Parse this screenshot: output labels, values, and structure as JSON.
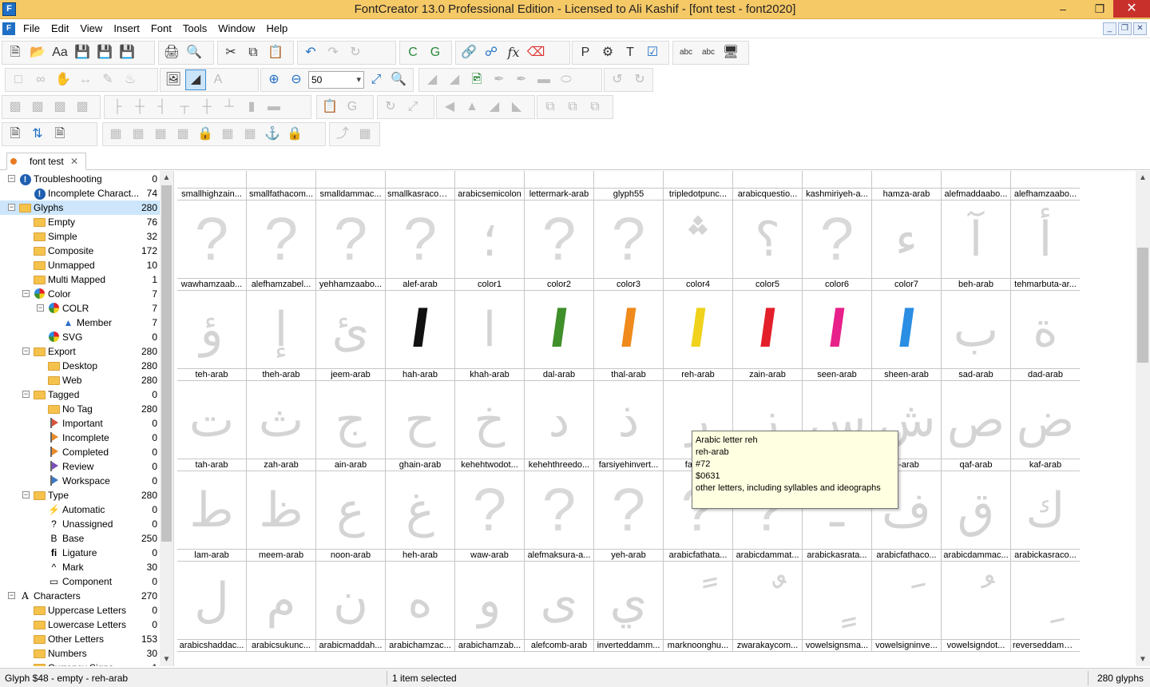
{
  "window": {
    "title": "FontCreator 13.0 Professional Edition - Licensed to Ali Kashif - [font test - font2020]"
  },
  "menu": [
    "File",
    "Edit",
    "View",
    "Insert",
    "Font",
    "Tools",
    "Window",
    "Help"
  ],
  "zoom": {
    "value": "50"
  },
  "doc_tab": {
    "label": "font test"
  },
  "tree": [
    {
      "label": "Troubleshooting",
      "count": "0",
      "icon": "warning-icon"
    },
    {
      "label": "Incomplete Charact...",
      "count": "74",
      "icon": "warning-icon"
    },
    {
      "label": "Glyphs",
      "count": "280",
      "icon": "folder-icon"
    },
    {
      "label": "Empty",
      "count": "76",
      "icon": "folder-icon"
    },
    {
      "label": "Simple",
      "count": "32",
      "icon": "folder-icon"
    },
    {
      "label": "Composite",
      "count": "172",
      "icon": "folder-icon"
    },
    {
      "label": "Unmapped",
      "count": "10",
      "icon": "folder-icon"
    },
    {
      "label": "Multi Mapped",
      "count": "1",
      "icon": "folder-icon"
    },
    {
      "label": "Color",
      "count": "7",
      "icon": "color-wheel-icon"
    },
    {
      "label": "COLR",
      "count": "7",
      "icon": "color-wheel-icon"
    },
    {
      "label": "Member",
      "count": "7",
      "icon": "triangle-icon"
    },
    {
      "label": "SVG",
      "count": "0",
      "icon": "color-wheel-icon"
    },
    {
      "label": "Export",
      "count": "280",
      "icon": "folder-icon"
    },
    {
      "label": "Desktop",
      "count": "280",
      "icon": "folder-icon"
    },
    {
      "label": "Web",
      "count": "280",
      "icon": "folder-icon"
    },
    {
      "label": "Tagged",
      "count": "0",
      "icon": "folder-icon"
    },
    {
      "label": "No Tag",
      "count": "280",
      "icon": "folder-icon"
    },
    {
      "label": "Important",
      "count": "0",
      "icon": "flag-icon"
    },
    {
      "label": "Incomplete",
      "count": "0",
      "icon": "flag-icon"
    },
    {
      "label": "Completed",
      "count": "0",
      "icon": "flag-icon"
    },
    {
      "label": "Review",
      "count": "0",
      "icon": "flag-icon"
    },
    {
      "label": "Workspace",
      "count": "0",
      "icon": "flag-icon"
    },
    {
      "label": "Type",
      "count": "280",
      "icon": "folder-icon"
    },
    {
      "label": "Automatic",
      "count": "0",
      "icon": "lightning-icon"
    },
    {
      "label": "Unassigned",
      "count": "0",
      "icon": "question-icon"
    },
    {
      "label": "Base",
      "count": "250",
      "icon": "letter-b-icon"
    },
    {
      "label": "Ligature",
      "count": "0",
      "icon": "ligature-icon"
    },
    {
      "label": "Mark",
      "count": "30",
      "icon": "caret-icon"
    },
    {
      "label": "Component",
      "count": "0",
      "icon": "component-icon"
    },
    {
      "label": "Characters",
      "count": "270",
      "icon": "letter-a-icon"
    },
    {
      "label": "Uppercase Letters",
      "count": "0",
      "icon": "folder-icon"
    },
    {
      "label": "Lowercase Letters",
      "count": "0",
      "icon": "folder-icon"
    },
    {
      "label": "Other Letters",
      "count": "153",
      "icon": "folder-icon"
    },
    {
      "label": "Numbers",
      "count": "30",
      "icon": "folder-icon"
    },
    {
      "label": "Currency Signs",
      "count": "1",
      "icon": "folder-icon"
    }
  ],
  "glyph_rows": [
    [
      {
        "name": "smallhighzain...",
        "glyph": "",
        "color": ""
      },
      {
        "name": "smallfathacom...",
        "glyph": "",
        "color": ""
      },
      {
        "name": "smalldammac...",
        "glyph": "",
        "color": ""
      },
      {
        "name": "smallkasracom...",
        "glyph": "",
        "color": ""
      },
      {
        "name": "arabicsemicolon",
        "glyph": "",
        "color": ""
      },
      {
        "name": "lettermark-arab",
        "glyph": "",
        "color": ""
      },
      {
        "name": "glyph55",
        "glyph": "",
        "color": ""
      },
      {
        "name": "tripledotpunc...",
        "glyph": "",
        "color": ""
      },
      {
        "name": "arabicquestio...",
        "glyph": "",
        "color": ""
      },
      {
        "name": "kashmiriyeh-a...",
        "glyph": "",
        "color": ""
      },
      {
        "name": "hamza-arab",
        "glyph": "",
        "color": ""
      },
      {
        "name": "alefmaddaabo...",
        "glyph": "",
        "color": ""
      },
      {
        "name": "alefhamzaabo...",
        "glyph": "",
        "color": ""
      }
    ],
    [
      {
        "name": "wawhamzaab...",
        "glyph": "?",
        "color": ""
      },
      {
        "name": "alefhamzabel...",
        "glyph": "?",
        "color": ""
      },
      {
        "name": "yehhamzaabo...",
        "glyph": "?",
        "color": ""
      },
      {
        "name": "alef-arab",
        "glyph": "?",
        "color": ""
      },
      {
        "name": "color1",
        "glyph": "؛",
        "color": ""
      },
      {
        "name": "color2",
        "glyph": "?",
        "color": ""
      },
      {
        "name": "color3",
        "glyph": "?",
        "color": ""
      },
      {
        "name": "color4",
        "glyph": "؞",
        "color": ""
      },
      {
        "name": "color5",
        "glyph": "؟",
        "color": ""
      },
      {
        "name": "color6",
        "glyph": "?",
        "color": ""
      },
      {
        "name": "color7",
        "glyph": "ء",
        "color": ""
      },
      {
        "name": "beh-arab",
        "glyph": "آ",
        "color": ""
      },
      {
        "name": "tehmarbuta-ar...",
        "glyph": "أ",
        "color": ""
      }
    ],
    [
      {
        "name": "teh-arab",
        "glyph": "ؤ",
        "color": ""
      },
      {
        "name": "theh-arab",
        "glyph": "إ",
        "color": ""
      },
      {
        "name": "jeem-arab",
        "glyph": "ئ",
        "color": ""
      },
      {
        "name": "hah-arab",
        "glyph": "ا",
        "color": "#111111"
      },
      {
        "name": "khah-arab",
        "glyph": "ا",
        "color": ""
      },
      {
        "name": "dal-arab",
        "glyph": "ا",
        "color": "#3f8f2a"
      },
      {
        "name": "thal-arab",
        "glyph": "ا",
        "color": "#f08a1c"
      },
      {
        "name": "reh-arab",
        "glyph": "ا",
        "color": "#f0d21c"
      },
      {
        "name": "zain-arab",
        "glyph": "ا",
        "color": "#e3202a"
      },
      {
        "name": "seen-arab",
        "glyph": "ا",
        "color": "#e8208a"
      },
      {
        "name": "sheen-arab",
        "glyph": "ا",
        "color": "#2a8ee3"
      },
      {
        "name": "sad-arab",
        "glyph": "ب",
        "color": ""
      },
      {
        "name": "dad-arab",
        "glyph": "ة",
        "color": ""
      }
    ],
    [
      {
        "name": "tah-arab",
        "glyph": "ت",
        "color": ""
      },
      {
        "name": "zah-arab",
        "glyph": "ث",
        "color": ""
      },
      {
        "name": "ain-arab",
        "glyph": "ج",
        "color": ""
      },
      {
        "name": "ghain-arab",
        "glyph": "ح",
        "color": ""
      },
      {
        "name": "kehehtwodot...",
        "glyph": "خ",
        "color": ""
      },
      {
        "name": "kehehthreedo...",
        "glyph": "د",
        "color": ""
      },
      {
        "name": "farsiyehinvert...",
        "glyph": "ذ",
        "color": ""
      },
      {
        "name": "farsiye",
        "glyph": "ر",
        "color": ""
      },
      {
        "name": "",
        "glyph": "ز",
        "color": ""
      },
      {
        "name": "",
        "glyph": "س",
        "color": ""
      },
      {
        "name": "h-arab",
        "glyph": "ش",
        "color": ""
      },
      {
        "name": "qaf-arab",
        "glyph": "ص",
        "color": ""
      },
      {
        "name": "kaf-arab",
        "glyph": "ض",
        "color": ""
      }
    ],
    [
      {
        "name": "lam-arab",
        "glyph": "ط",
        "color": ""
      },
      {
        "name": "meem-arab",
        "glyph": "ظ",
        "color": ""
      },
      {
        "name": "noon-arab",
        "glyph": "ع",
        "color": ""
      },
      {
        "name": "heh-arab",
        "glyph": "غ",
        "color": ""
      },
      {
        "name": "waw-arab",
        "glyph": "?",
        "color": ""
      },
      {
        "name": "alefmaksura-a...",
        "glyph": "?",
        "color": ""
      },
      {
        "name": "yeh-arab",
        "glyph": "?",
        "color": ""
      },
      {
        "name": "arabicfathata...",
        "glyph": "?",
        "color": ""
      },
      {
        "name": "arabicdammat...",
        "glyph": "?",
        "color": ""
      },
      {
        "name": "arabickasrata...",
        "glyph": "ـ",
        "color": ""
      },
      {
        "name": "arabicfathaco...",
        "glyph": "ف",
        "color": ""
      },
      {
        "name": "arabicdammac...",
        "glyph": "ق",
        "color": ""
      },
      {
        "name": "arabickasraco...",
        "glyph": "ك",
        "color": ""
      }
    ],
    [
      {
        "name": "arabicshaddac...",
        "glyph": "ل",
        "color": ""
      },
      {
        "name": "arabicsukunc...",
        "glyph": "م",
        "color": ""
      },
      {
        "name": "arabicmaddah...",
        "glyph": "ن",
        "color": ""
      },
      {
        "name": "arabichamzac...",
        "glyph": "ه",
        "color": ""
      },
      {
        "name": "arabichamzab...",
        "glyph": "و",
        "color": ""
      },
      {
        "name": "alefcomb-arab",
        "glyph": "ى",
        "color": ""
      },
      {
        "name": "inverteddamm...",
        "glyph": "ي",
        "color": ""
      },
      {
        "name": "marknoonghu...",
        "glyph": "ً",
        "color": ""
      },
      {
        "name": "zwarakaycom...",
        "glyph": "ٌ",
        "color": ""
      },
      {
        "name": "vowelsignsma...",
        "glyph": "ٍ",
        "color": ""
      },
      {
        "name": "vowelsigninve...",
        "glyph": "َ",
        "color": ""
      },
      {
        "name": "vowelsigndot...",
        "glyph": "ُ",
        "color": ""
      },
      {
        "name": "reverseddamm...",
        "glyph": "ِ",
        "color": ""
      }
    ]
  ],
  "tooltip": {
    "line1": "Arabic letter reh",
    "line2": "reh-arab",
    "line3": "#72",
    "line4": "$0631",
    "line5": "other letters, including syllables and ideographs"
  },
  "status": {
    "left": "Glyph $48 - empty - reh-arab",
    "middle": "1 item selected",
    "right": "280 glyphs"
  }
}
